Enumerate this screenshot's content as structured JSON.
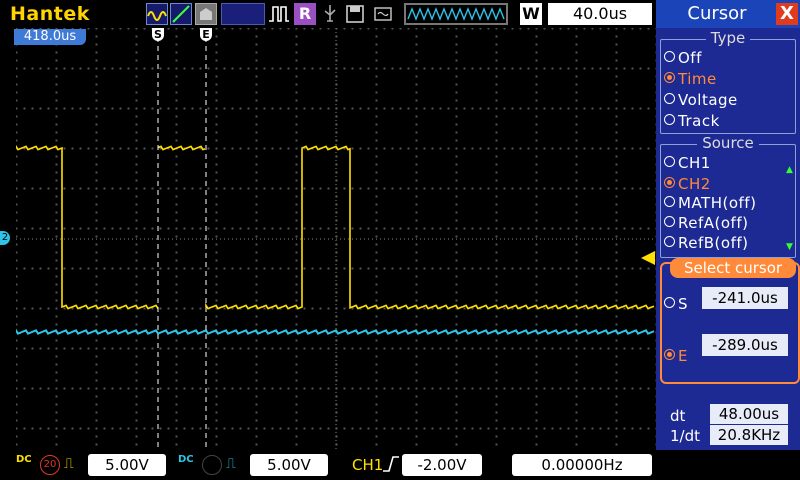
{
  "brand": "Hantek",
  "toolbar": {
    "mode_r": "R",
    "mode_w": "W",
    "timebase": "40.0us"
  },
  "screen": {
    "trigger_position": "418.0us",
    "cursor_s_label": "S",
    "cursor_e_label": "E",
    "ground_marker": "2"
  },
  "panel": {
    "title": "Cursor",
    "close": "X",
    "type_legend": "Type",
    "type_options": [
      "Off",
      "Time",
      "Voltage",
      "Track"
    ],
    "type_selected": "Time",
    "source_legend": "Source",
    "source_options": [
      "CH1",
      "CH2",
      "MATH(off)",
      "RefA(off)",
      "RefB(off)"
    ],
    "source_selected": "CH2",
    "select_cursor_label": "Select cursor",
    "s_label": "S",
    "s_value": "-241.0us",
    "e_label": "E",
    "e_value": "-289.0us",
    "dt_label": "dt",
    "dt_value": "48.00us",
    "inv_dt_label": "1/dt",
    "inv_dt_value": "20.8KHz"
  },
  "bottombar": {
    "ch1_coupling": "DC",
    "ch1_bw": "20",
    "ch1_scale": "5.00V",
    "ch2_coupling": "DC",
    "ch2_scale": "5.00V",
    "trigger_source": "CH1",
    "trigger_level": "-2.00V",
    "frequency": "0.00000Hz"
  },
  "colors": {
    "ch1": "#ffe000",
    "ch2": "#2ec4e8",
    "accent": "#ff8a3a",
    "panel": "#1e2a93"
  }
}
